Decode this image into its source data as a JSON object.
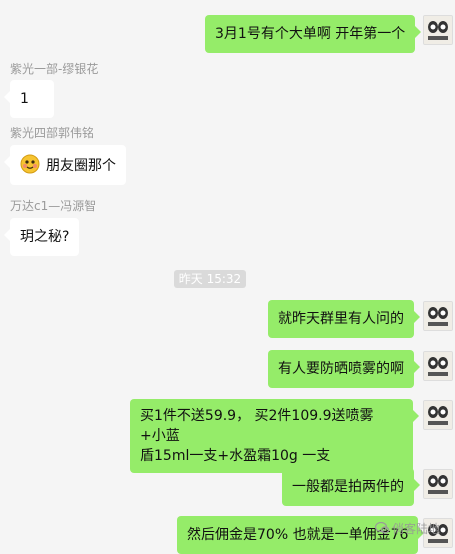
{
  "messages": {
    "m1": "3月1号有个大单啊 开年第一个",
    "m2_sender": "紫光一部-缪银花",
    "m2": "1",
    "m3_sender": "紫光四部郭伟铭",
    "m3": "朋友圈那个",
    "m4_sender": "万达c1—冯源智",
    "m4": "玥之秘?",
    "timestamp": "昨天 15:32",
    "m5": "就昨天群里有人问的",
    "m6": "有人要防晒喷雾的啊",
    "m7_line1": "买1件不送59.9， 买2件109.9送喷雾 +小蓝",
    "m7_line2": "盾15ml一支+水盈霜10g 一支",
    "m8": "一般都是拍两件的",
    "m9": "然后佣金是70% 也就是一单佣金76"
  },
  "watermark": "俏客陆地",
  "colors": {
    "background": "#f5f5f5",
    "bubble_out": "#95ec69",
    "bubble_in": "#ffffff",
    "sender_text": "#9a9a9a"
  },
  "icons": {
    "avatar": "avatar-icon",
    "emoji": "smiling-face-icon",
    "watermark_logo": "chat-bubble-icon"
  }
}
